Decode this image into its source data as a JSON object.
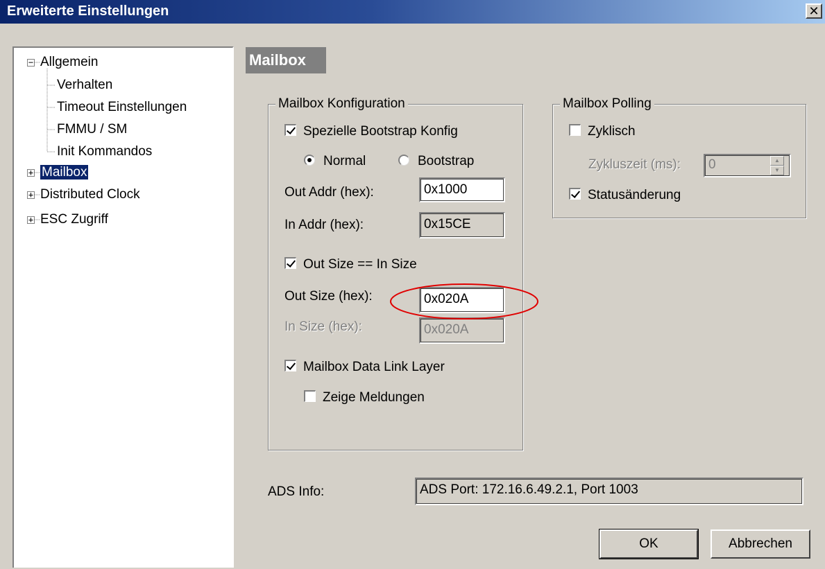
{
  "window": {
    "title": "Erweiterte Einstellungen",
    "close_glyph": "✕"
  },
  "tree": {
    "items": [
      {
        "label": "Allgemein",
        "expander": "−"
      },
      {
        "label": "Verhalten"
      },
      {
        "label": "Timeout Einstellungen"
      },
      {
        "label": "FMMU / SM"
      },
      {
        "label": "Init Kommandos"
      },
      {
        "label": "Mailbox",
        "expander": "+",
        "selected": true
      },
      {
        "label": "Distributed Clock",
        "expander": "+"
      },
      {
        "label": "ESC Zugriff",
        "expander": "+"
      }
    ]
  },
  "panel": {
    "header": "Mailbox",
    "config": {
      "title": "Mailbox Konfiguration",
      "bootstrap_label": "Spezielle Bootstrap Konfig",
      "radio_normal": "Normal",
      "radio_bootstrap": "Bootstrap",
      "out_addr_label": "Out Addr (hex):",
      "out_addr_value": "0x1000",
      "in_addr_label": "In Addr (hex):",
      "in_addr_value": "0x15CE",
      "size_equal_label": "Out Size == In Size",
      "out_size_label": "Out Size (hex):",
      "out_size_value": "0x020A",
      "in_size_label": "In Size (hex):",
      "in_size_value": "0x020A",
      "dll_label": "Mailbox Data Link Layer",
      "show_msgs_label": "Zeige Meldungen"
    },
    "polling": {
      "title": "Mailbox Polling",
      "cyclic_label": "Zyklisch",
      "cycle_time_label": "Zykluszeit (ms):",
      "cycle_time_value": "0",
      "status_change_label": "Statusänderung"
    },
    "ads": {
      "label": "ADS Info:",
      "value": "ADS Port: 172.16.6.49.2.1, Port 1003"
    },
    "buttons": {
      "ok": "OK",
      "cancel": "Abbrechen"
    }
  },
  "colors": {
    "titlebar_start": "#0a246a",
    "selection": "#0a246a",
    "highlight_ellipse": "#e00000",
    "dialog_face": "#d4d0c8"
  }
}
